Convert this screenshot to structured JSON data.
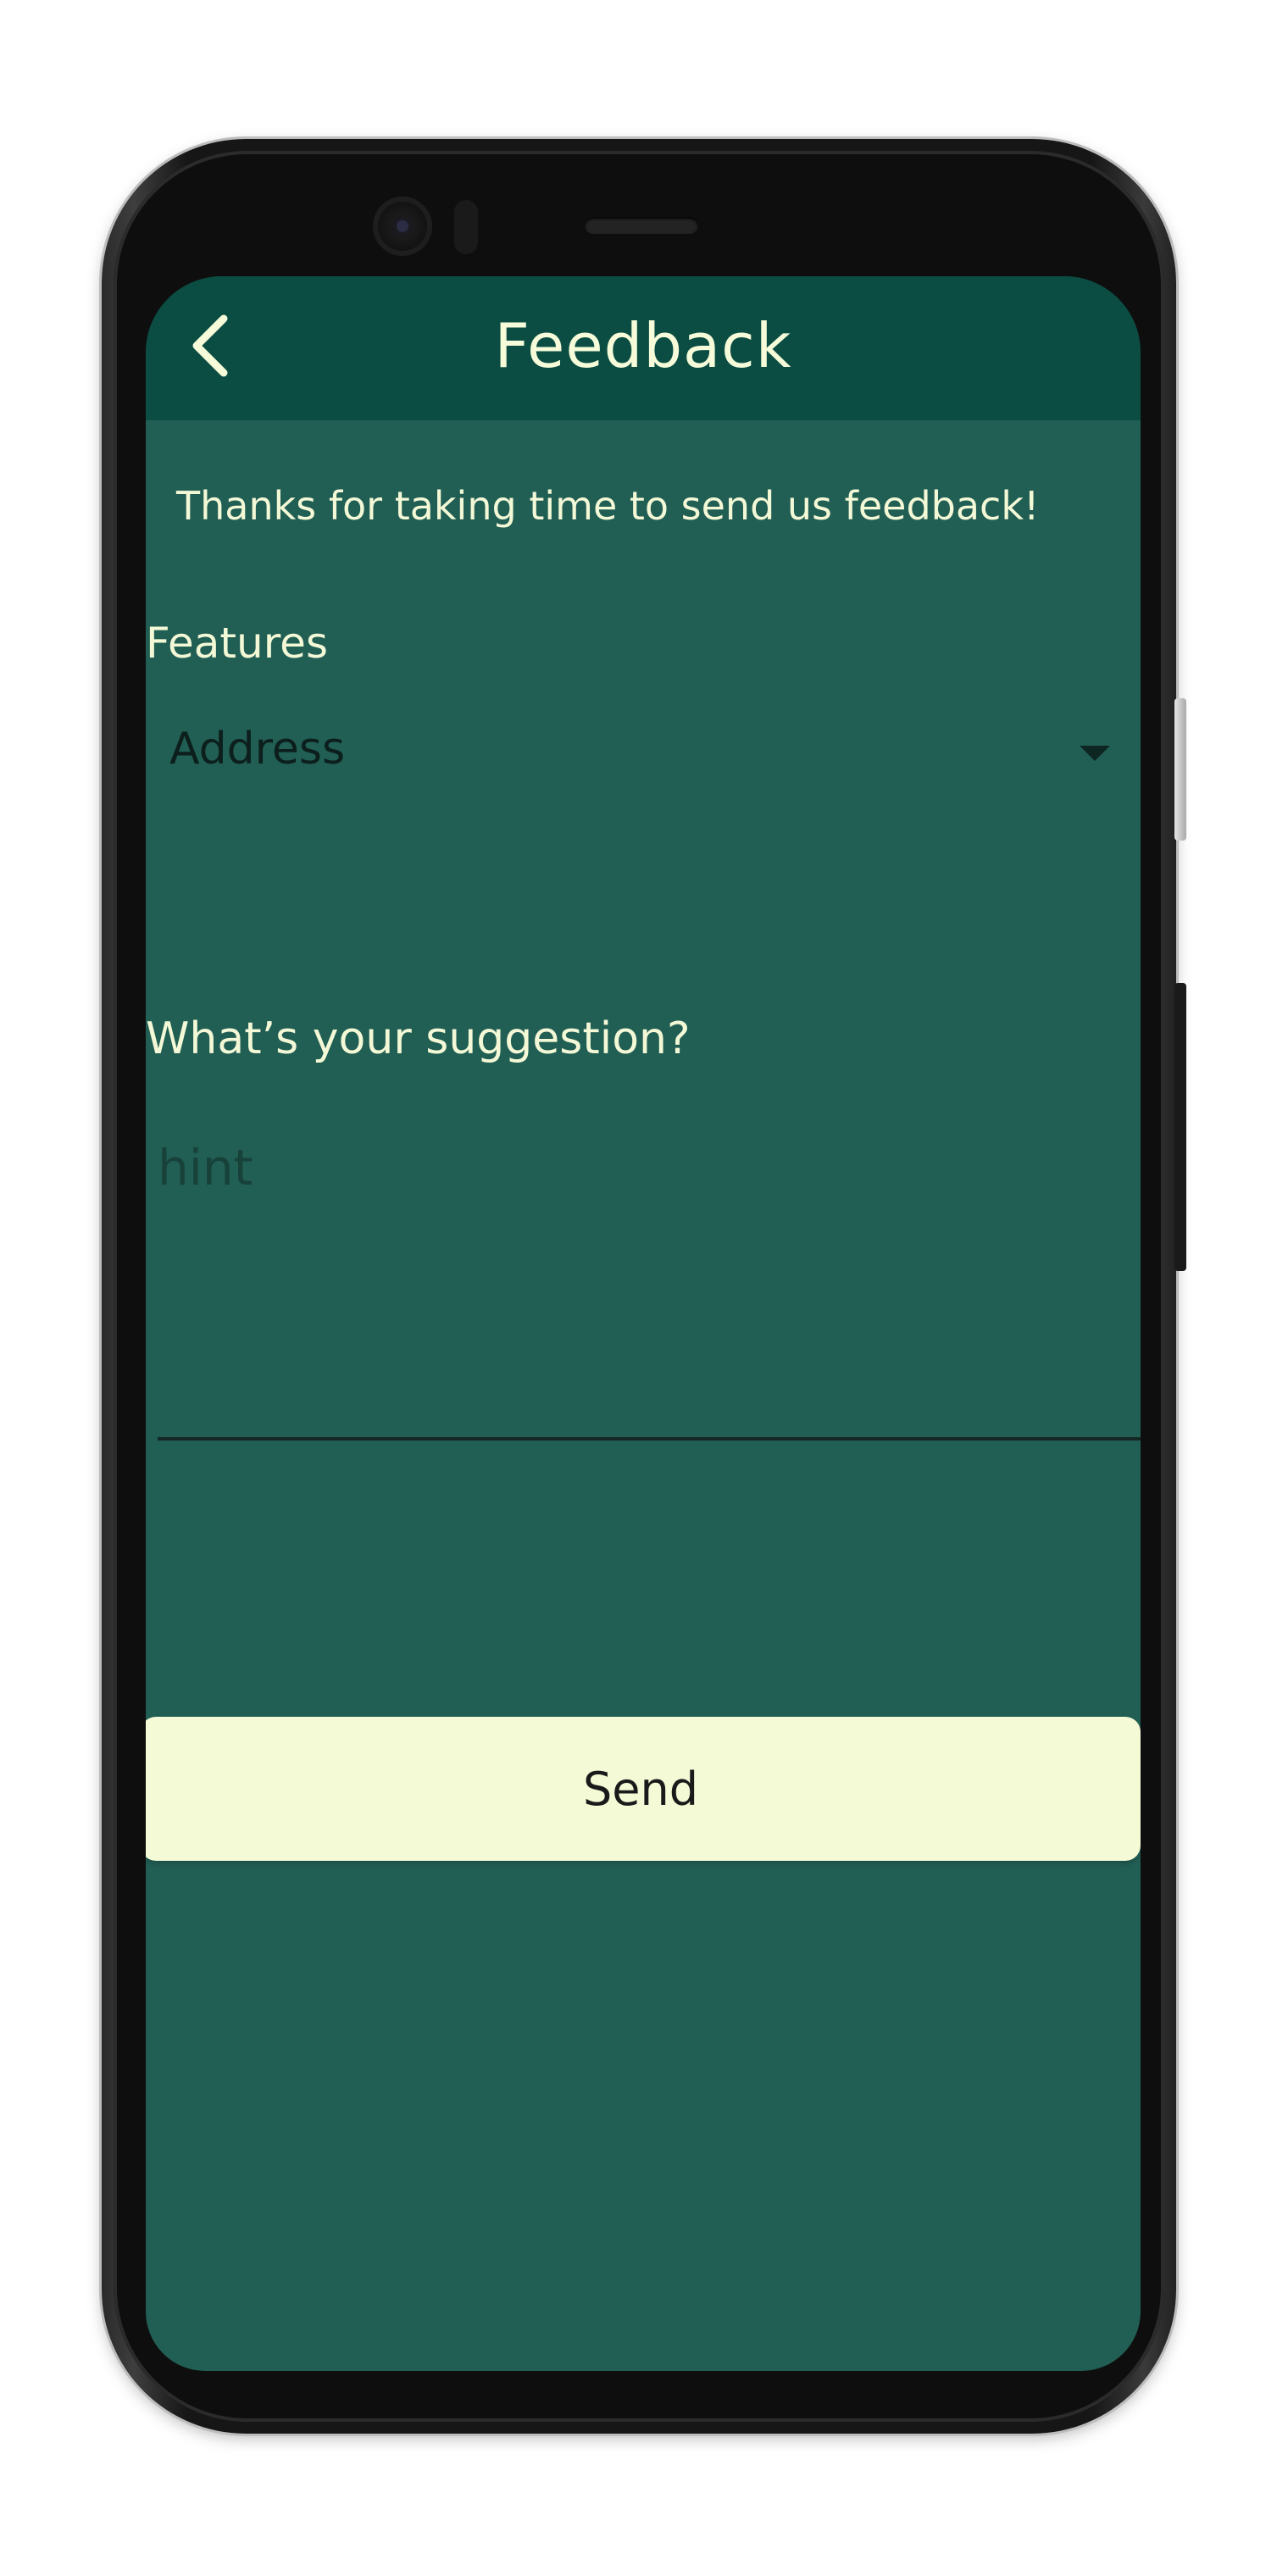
{
  "app": {
    "title": "Feedback",
    "back_icon": "chevron-left-icon"
  },
  "intro_text": "Thanks for taking time to send us feedback!",
  "features": {
    "label": "Features",
    "selected_value": "Address",
    "arrow_icon": "dropdown-arrow-icon"
  },
  "suggestion": {
    "label": "What’s your suggestion?",
    "placeholder": "hint",
    "value": ""
  },
  "actions": {
    "send_label": "Send"
  },
  "colors": {
    "app_bar": "#0b4d43",
    "background": "#215e54",
    "text_light": "#f3f8d6",
    "button_bg": "#f4f9d6"
  }
}
